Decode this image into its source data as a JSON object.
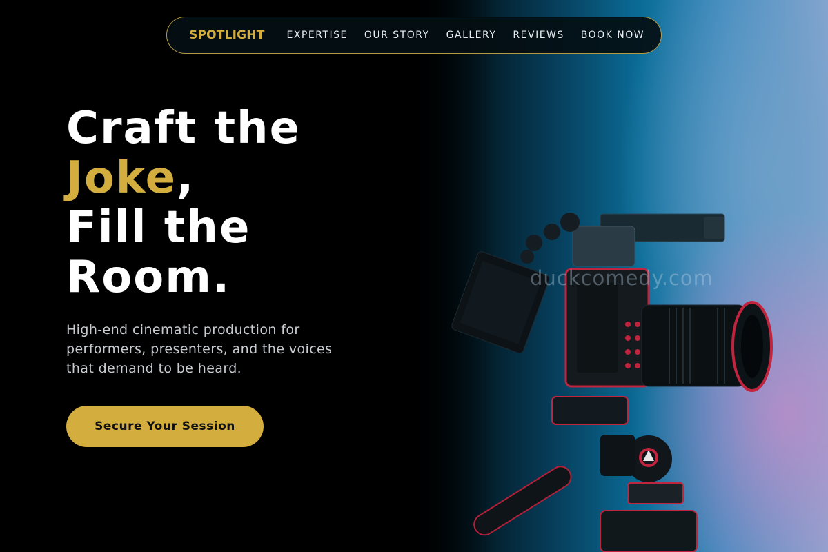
{
  "nav": {
    "brand": "SPOTLIGHT",
    "links": [
      {
        "label": "EXPERTISE"
      },
      {
        "label": "OUR STORY"
      },
      {
        "label": "GALLERY"
      },
      {
        "label": "REVIEWS"
      },
      {
        "label": "BOOK NOW"
      }
    ]
  },
  "hero": {
    "headline_line1": "Craft the",
    "headline_accent": "Joke",
    "headline_comma": ",",
    "headline_line3": "Fill the",
    "headline_line4": "Room.",
    "subtext": "High-end cinematic production for performers, presenters, and the voices that demand to be heard.",
    "cta_label": "Secure Your Session"
  },
  "watermark": "duckcomedy.com",
  "colors": {
    "accent": "#d4ad3f",
    "background": "#000000",
    "text": "#ffffff"
  }
}
